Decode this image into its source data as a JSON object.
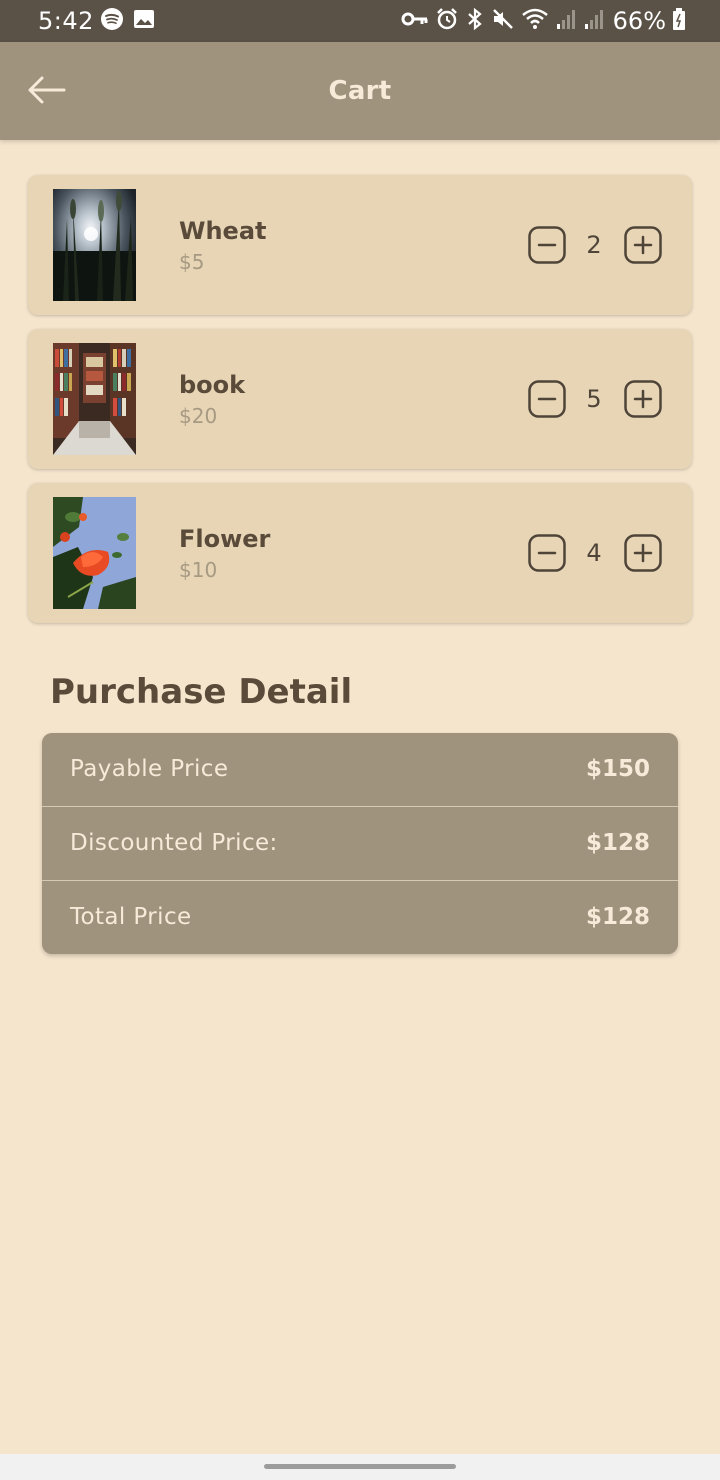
{
  "status_bar": {
    "time": "5:42",
    "battery_percent": "66%",
    "icons_left": [
      "spotify-icon",
      "image-icon"
    ],
    "icons_right": [
      "vpn-key-icon",
      "alarm-icon",
      "bluetooth-icon",
      "mute-icon",
      "wifi-icon",
      "signal-icon",
      "signal-icon",
      "battery-icon"
    ]
  },
  "app_bar": {
    "title": "Cart",
    "back_icon": "arrow-left-icon"
  },
  "cart": {
    "items": [
      {
        "name": "Wheat",
        "price": "$5",
        "quantity": "2"
      },
      {
        "name": "book",
        "price": "$20",
        "quantity": "5"
      },
      {
        "name": "Flower",
        "price": "$10",
        "quantity": "4"
      }
    ]
  },
  "purchase_detail": {
    "title": "Purchase Detail",
    "rows": [
      {
        "label": "Payable Price",
        "value": "$150"
      },
      {
        "label": "Discounted Price:",
        "value": "$128"
      },
      {
        "label": "Total Price",
        "value": "$128"
      }
    ]
  },
  "colors": {
    "background": "#f5e5cd",
    "app_bar": "#9f937e",
    "card": "#e7d5b5",
    "text_dark": "#5a4a3a",
    "text_muted": "#a79a83"
  }
}
